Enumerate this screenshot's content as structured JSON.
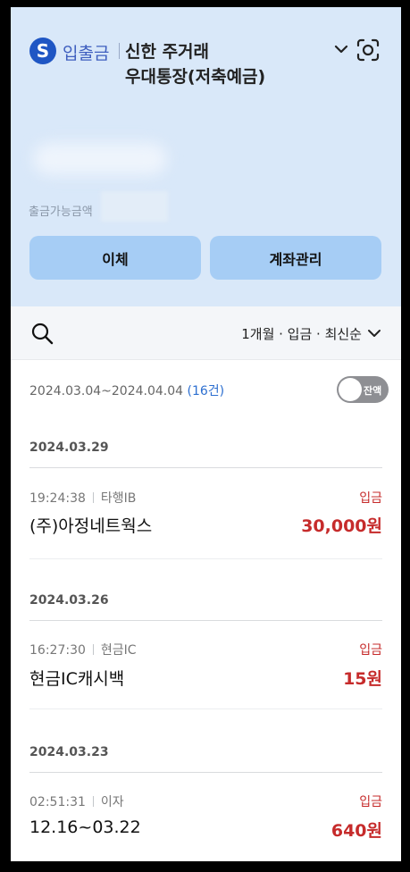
{
  "header": {
    "logo": "S",
    "account_type": "입출금",
    "account_name_line1": "신한 주거래",
    "account_name_line2": "우대통장(저축예금)",
    "available_label": "출금가능금액",
    "transfer_button": "이체",
    "account_manage_button": "계좌관리"
  },
  "filter": {
    "label": "1개월 · 입금 · 최신순"
  },
  "period": {
    "range": "2024.03.04~2024.04.04",
    "count": "(16건)",
    "toggle_label": "잔액"
  },
  "transactions": [
    {
      "date": "2024.03.29",
      "time": "19:24:38",
      "channel": "타행IB",
      "type": "입금",
      "name": "(주)아정네트웍스",
      "amount": "30,000원"
    },
    {
      "date": "2024.03.26",
      "time": "16:27:30",
      "channel": "현금IC",
      "type": "입금",
      "name": "현금IC캐시백",
      "amount": "15원"
    },
    {
      "date": "2024.03.23",
      "time": "02:51:31",
      "channel": "이자",
      "type": "입금",
      "name": "12.16~03.22",
      "amount": "640원"
    }
  ],
  "colors": {
    "header_bg": "#d9e8f9",
    "button_bg": "#a6cdf5",
    "deposit_red": "#c62b2b",
    "count_blue": "#2d6fd0",
    "logo_blue": "#1f56c4"
  }
}
